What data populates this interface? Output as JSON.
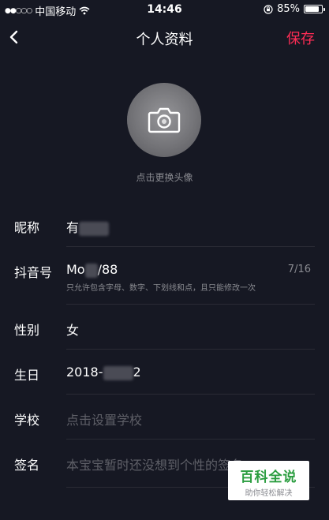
{
  "status_bar": {
    "signal": "●●○○○",
    "carrier": "中国移动",
    "time": "14:46",
    "battery_percent": "85%",
    "battery_level": 0.85
  },
  "nav": {
    "title": "个人资料",
    "save_label": "保存"
  },
  "avatar": {
    "hint": "点击更换头像"
  },
  "form": {
    "nickname": {
      "label": "昵称",
      "value_prefix": "有"
    },
    "douyin_id": {
      "label": "抖音号",
      "value_prefix": "Mo",
      "value_suffix": "/88",
      "counter": "7/16",
      "hint": "只允许包含字母、数字、下划线和点，且只能修改一次"
    },
    "gender": {
      "label": "性别",
      "value": "女"
    },
    "birthday": {
      "label": "生日",
      "value_prefix": "2018-",
      "value_suffix": "2"
    },
    "school": {
      "label": "学校",
      "placeholder": "点击设置学校"
    },
    "signature": {
      "label": "签名",
      "placeholder": "本宝宝暂时还没想到个性的签名"
    }
  },
  "watermark": {
    "title": "百科全说",
    "subtitle": "助你轻松解决"
  },
  "colors": {
    "background": "#161823",
    "accent": "#fe2c55",
    "muted_text": "#8a8b91",
    "placeholder_text": "#5e5f67"
  }
}
